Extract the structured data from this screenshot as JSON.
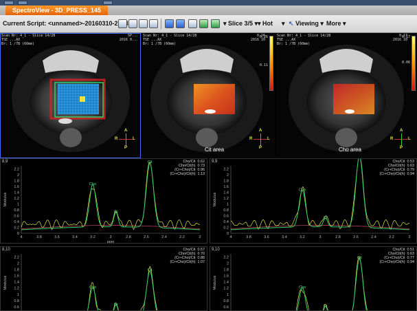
{
  "app": {
    "tab_title": "SpectroView - 3D_PRESS_145"
  },
  "toolbar": {
    "script_label": "Current Script: <unnamed>-20160310-223354",
    "slice_label": "Slice 3/5",
    "colormap_label": "Hot",
    "viewing_label": "Viewing",
    "more_label": "More"
  },
  "panes": [
    {
      "info_left": "Scan Nr: 4_1 - Slice 14/28\nTSE ...AX\nBr: 1 /7B (60mm)",
      "info_right": "SP...\n2016 0...",
      "label": "",
      "colorbar": false
    },
    {
      "info_left": "Scan Nr: 4_1 - Slice 14/28\nTSE ...AX\nBr: 1 /7B (60mm)",
      "info_right": "0.26\n2016 10",
      "label": "Cit area",
      "colorbar": true,
      "cb_top": "0.26",
      "cb_low": "0.11"
    },
    {
      "info_left": "Scan Nr: 4_1 - Slice 14/28\nTSE ...AX\nBr: 1 /7B (60mm)",
      "info_right": "0.17\n2016 10",
      "label": "Cho area",
      "colorbar": true,
      "cb_top": "0.17",
      "cb_low": "0.06"
    }
  ],
  "orientation": {
    "a": "A",
    "p": "P",
    "r": "R",
    "l": "L"
  },
  "spectra": [
    {
      "id": "8,9",
      "ratios": [
        "Cho/Cit  0.62",
        "Cho/Cit(h)  0.73",
        "(Cr+Cho)/Cit  0.96",
        "(Cr+Cho)/Cit(h)  1.13"
      ],
      "peaks": {
        "cit": 2.2,
        "cho": 1.45,
        "cr": 0.5
      },
      "yticks": [
        "2.2",
        "2",
        "1.8",
        "1.6",
        "1.4",
        "1.2",
        "1",
        "0.8",
        "0.6",
        "0.4",
        "0.2",
        "0"
      ],
      "xticks": [
        "4",
        "3.8",
        "3.6",
        "3.4",
        "3.2",
        "3",
        "2.8",
        "2.6",
        "2.4",
        "2.2",
        "2"
      ],
      "ylabel": "Modulus",
      "xlabel": "ppm",
      "peak_labels": {
        "cit": "Cit",
        "cho": "Cho",
        "cr": "Cr"
      }
    },
    {
      "id": "9,9",
      "ratios": [
        "Cho/Cit  0.53",
        "Cho/Cit(h)  0.63",
        "(Cr+Cho)/Cit  0.79",
        "(Cr+Cho)/Cit(h)  0.94"
      ],
      "peaks": {
        "cit": 2.45,
        "cho": 1.25,
        "cr": 0.3
      },
      "yticks": [
        "2.2",
        "2",
        "1.8",
        "1.6",
        "1.4",
        "1.2",
        "1",
        "0.8",
        "0.6",
        "0.4",
        "0.2",
        "0"
      ],
      "xticks": [
        "4",
        "3.8",
        "3.6",
        "3.4",
        "3.2",
        "3",
        "2.8",
        "2.6",
        "2.4",
        "2.2",
        "2"
      ],
      "ylabel": "Modulus",
      "xlabel": "",
      "peak_labels": {
        "cit": "Cit",
        "cho": "Cho",
        "cr": "Cr"
      }
    },
    {
      "id": "8,10",
      "ratios": [
        "Cho/Cit  0.57",
        "Cho/Cit(h)  0.70",
        "(Cr+Cho)/Cit  0.88",
        "(Cr+Cho)/Cit(h)  1.07"
      ],
      "peaks": {
        "cit": 1.55,
        "cho": 1.0,
        "cr": 0.45
      },
      "yticks": [
        "2.2",
        "2",
        "1.8",
        "1.6",
        "1.4",
        "1.2",
        "1",
        "0.8",
        "0.6",
        "0.4"
      ],
      "xticks": [],
      "ylabel": "Modulus",
      "xlabel": "",
      "peak_labels": {
        "cit": "Cit",
        "cho": "Cho",
        "cr": "Cr"
      }
    },
    {
      "id": "9,10",
      "ratios": [
        "Cho/Cit  0.51",
        "Cho/Cit(h)  0.63",
        "(Cr+Cho)/Cit  0.77",
        "(Cr+Cho)/Cit(h)  0.94"
      ],
      "peaks": {
        "cit": 1.95,
        "cho": 1.0,
        "cr": 0.4
      },
      "yticks": [
        "2.2",
        "2",
        "1.8",
        "1.6",
        "1.4",
        "1.2",
        "1",
        "0.8",
        "0.6",
        "0.4"
      ],
      "xticks": [],
      "ylabel": "Modulus",
      "xlabel": "",
      "peak_labels": {
        "cit": "Cit",
        "cho": "Cho",
        "cr": "Cr"
      }
    }
  ],
  "colors": {
    "spectrum_fit": "#2fd06a",
    "spectrum_raw": "#e3e34a",
    "baseline": "#d04a6a",
    "tab_orange": "#f07a1a",
    "active_border": "#3f6fff"
  }
}
